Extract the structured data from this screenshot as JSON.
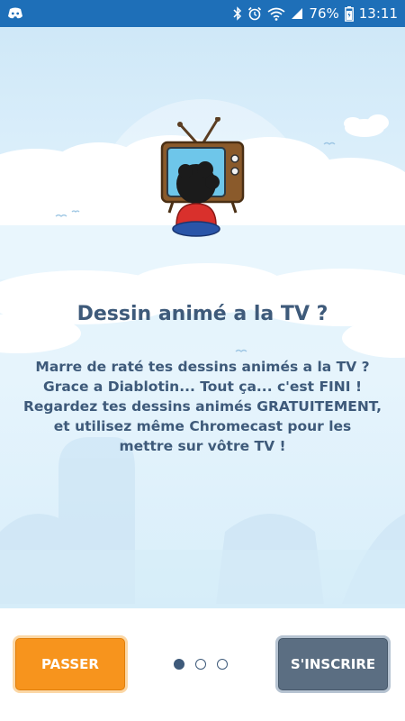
{
  "status_bar": {
    "battery": "76%",
    "time": "13:11",
    "icons": [
      "discord-icon",
      "bluetooth-icon",
      "alarm-icon",
      "wifi-icon",
      "signal-icon",
      "battery-icon"
    ]
  },
  "onboarding": {
    "title": "Dessin animé a la TV ?",
    "description_lines": [
      "Marre de raté tes dessins animés a la TV ?",
      "Grace a Diablotin... Tout ça... c'est FINI !",
      "Regardez tes dessins animés GRATUITEMENT,",
      "et utilisez même Chromecast pour les",
      "mettre sur vôtre TV !"
    ],
    "page_count": 3,
    "current_page": 1
  },
  "actions": {
    "skip_label": "PASSER",
    "register_label": "S'INSCRIRE"
  },
  "colors": {
    "status_bar": "#1e6fb8",
    "text": "#3e5a7a",
    "skip_button": "#f7941d",
    "register_button": "#5b6e82",
    "sky": "#d8eefa"
  }
}
